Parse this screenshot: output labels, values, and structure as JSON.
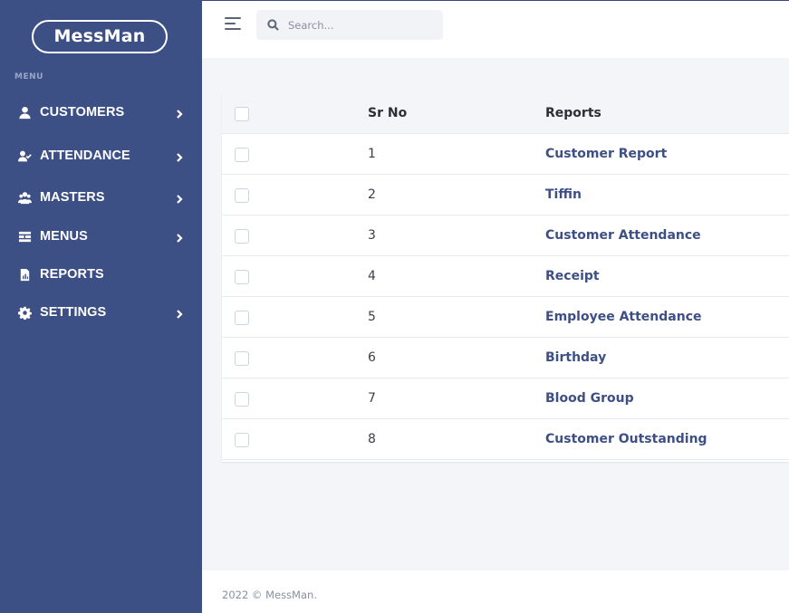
{
  "brand": {
    "name": "MessMan"
  },
  "sidebar": {
    "heading": "MENU",
    "items": [
      {
        "label": "CUSTOMERS",
        "icon": "user-icon",
        "has_submenu": true
      },
      {
        "label": "ATTENDANCE",
        "icon": "user-check-icon",
        "has_submenu": true
      },
      {
        "label": "MASTERS",
        "icon": "users-icon",
        "has_submenu": true
      },
      {
        "label": "MENUS",
        "icon": "list-icon",
        "has_submenu": true
      },
      {
        "label": "REPORTS",
        "icon": "report-file-icon",
        "has_submenu": false
      },
      {
        "label": "SETTINGS",
        "icon": "gear-icon",
        "has_submenu": true
      }
    ]
  },
  "topbar": {
    "search_placeholder": "Search..."
  },
  "table": {
    "columns": [
      "Sr No",
      "Reports"
    ],
    "rows": [
      {
        "sr": "1",
        "report": "Customer Report"
      },
      {
        "sr": "2",
        "report": "Tiffin"
      },
      {
        "sr": "3",
        "report": "Customer Attendance"
      },
      {
        "sr": "4",
        "report": "Receipt"
      },
      {
        "sr": "5",
        "report": "Employee Attendance"
      },
      {
        "sr": "6",
        "report": "Birthday"
      },
      {
        "sr": "7",
        "report": "Blood Group"
      },
      {
        "sr": "8",
        "report": "Customer Outstanding"
      }
    ]
  },
  "footer": {
    "text": "2022 © MessMan."
  },
  "colors": {
    "sidebar_bg": "#3d5086",
    "link": "#3d5086",
    "page_bg": "#f3f5f9"
  }
}
